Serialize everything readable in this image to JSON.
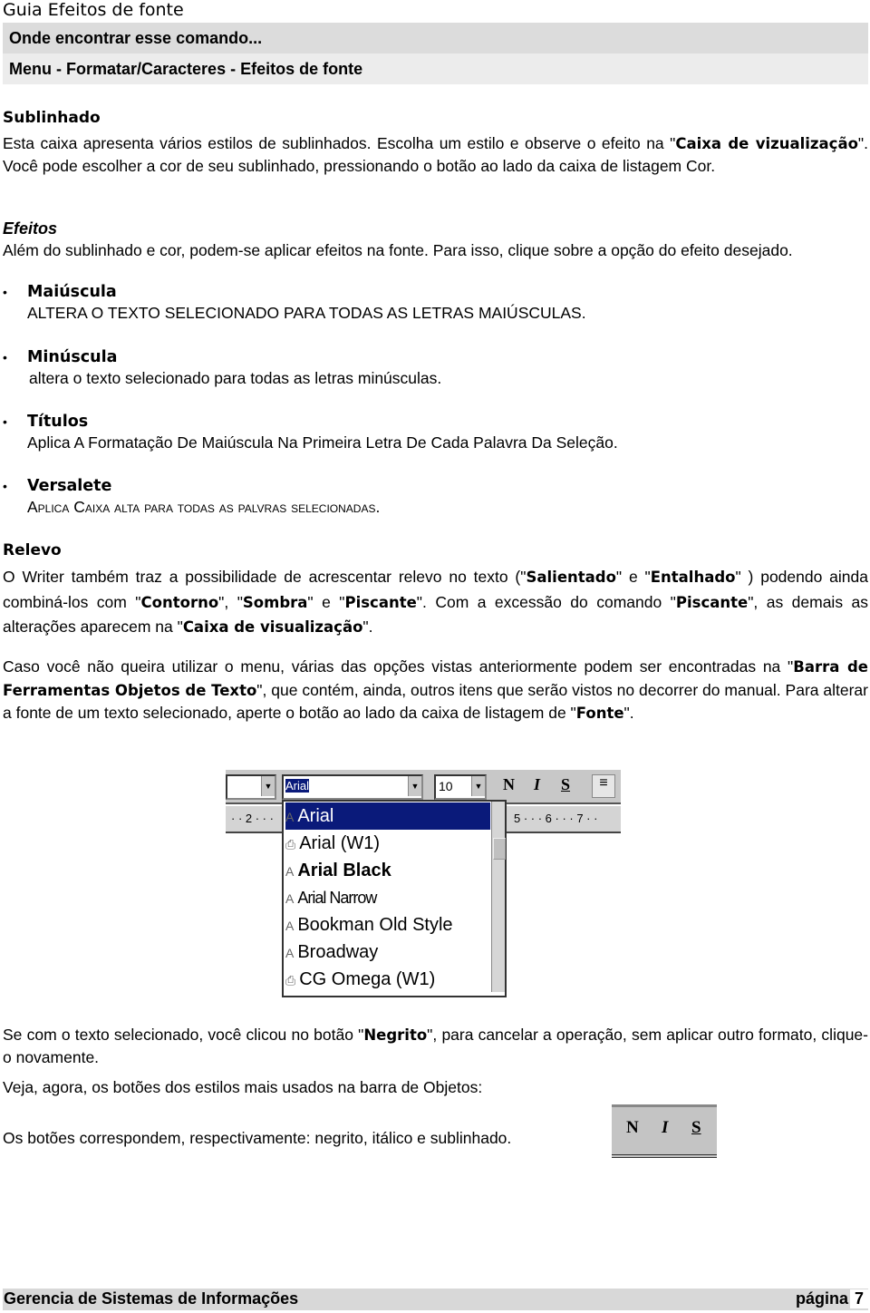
{
  "header": {
    "doc_title": "Guia Efeitos de fonte",
    "bar1": "Onde encontrar esse comando...",
    "bar2": "Menu - Formatar/Caracteres  - Efeitos de fonte"
  },
  "sublinhado": {
    "heading": "Sublinhado",
    "para": [
      {
        "t": "Esta caixa apresenta vários estilos de sublinhados. Escolha um estilo e observe o efeito na \""
      },
      {
        "t": "Caixa de vizualização",
        "b": true
      },
      {
        "t": "\".  Você pode escolher a cor de seu sublinhado, pressionando o botão ao lado da caixa de listagem Cor."
      }
    ]
  },
  "efeitos": {
    "heading": "Efeitos",
    "para": "Além do sublinhado e cor, podem-se aplicar efeitos na fonte. Para isso, clique sobre a opção do efeito desejado.",
    "items": [
      {
        "title": "Maiúscula",
        "desc": "ALTERA O TEXTO SELECIONADO PARA TODAS AS LETRAS MAIÚSCULAS."
      },
      {
        "title": "Minúscula",
        "desc": "altera o texto selecionado para todas as letras minúsculas."
      },
      {
        "title": "Títulos",
        "desc": "Aplica A Formatação De Maiúscula Na Primeira Letra De Cada Palavra Da Seleção."
      },
      {
        "title": "Versalete",
        "desc": "Aplica Caixa alta para todas as palvras selecionadas."
      }
    ]
  },
  "relevo": {
    "heading": "Relevo",
    "para": [
      {
        "t": "O Writer também traz a possibilidade de acrescentar relevo no texto (\""
      },
      {
        "t": "Salientado",
        "b": true
      },
      {
        "t": "\" e \""
      },
      {
        "t": "Entalhado",
        "b": true
      },
      {
        "t": "\" ) podendo ainda combiná-los com \""
      },
      {
        "t": "Contorno",
        "b": true
      },
      {
        "t": "\", \""
      },
      {
        "t": "Sombra",
        "b": true
      },
      {
        "t": "\" e \""
      },
      {
        "t": "Piscante",
        "b": true
      },
      {
        "t": "\". Com a excessão do comando \""
      },
      {
        "t": "Piscante",
        "b": true
      },
      {
        "t": "\",  as demais as alterações aparecem na \""
      },
      {
        "t": "Caixa de visualização",
        "b": true
      },
      {
        "t": "\"."
      }
    ]
  },
  "caso": {
    "para": [
      {
        "t": "Caso você não queira utilizar o menu, várias das opções vistas anteriormente podem ser encontradas na \""
      },
      {
        "t": "Barra de Ferramentas Objetos de Texto",
        "b": true
      },
      {
        "t": "\", que contém, ainda, outros itens que serão vistos no decorrer do manual. Para alterar a fonte de um texto selecionado, aperte o botão ao lado da caixa de listagem de \""
      },
      {
        "t": "Fonte",
        "b": true
      },
      {
        "t": "\"."
      }
    ]
  },
  "screenshot": {
    "font_value": "Arial",
    "size_value": "10",
    "bold": "N",
    "italic": "I",
    "underline": "S",
    "ruler_left": "· · 2 · · ·",
    "ruler_right": "5 · · · 6 · · · 7 · ·",
    "fonts": [
      "Arial",
      "Arial (W1)",
      "Arial Black",
      "Arial Narrow",
      "Bookman Old Style",
      "Broadway",
      "CG Omega (W1)"
    ],
    "selected_color": "#0a1a7a"
  },
  "negrito": {
    "para": [
      {
        "t": "Se com o texto selecionado, você clicou no botão \""
      },
      {
        "t": "Negrito",
        "b": true
      },
      {
        "t": "\", para cancelar a operação, sem aplicar outro formato, clique-o novamente."
      }
    ]
  },
  "veja": "Veja, agora, os botões dos estilos mais usados na barra de Objetos:",
  "botoes": {
    "text": "Os botões correspondem, respectivamente: negrito, itálico e sublinhado.",
    "bold": "N",
    "italic": "I",
    "underline": "S"
  },
  "footer": {
    "left": "Gerencia de Sistemas de Informações",
    "right_label": "página",
    "page": "7"
  }
}
